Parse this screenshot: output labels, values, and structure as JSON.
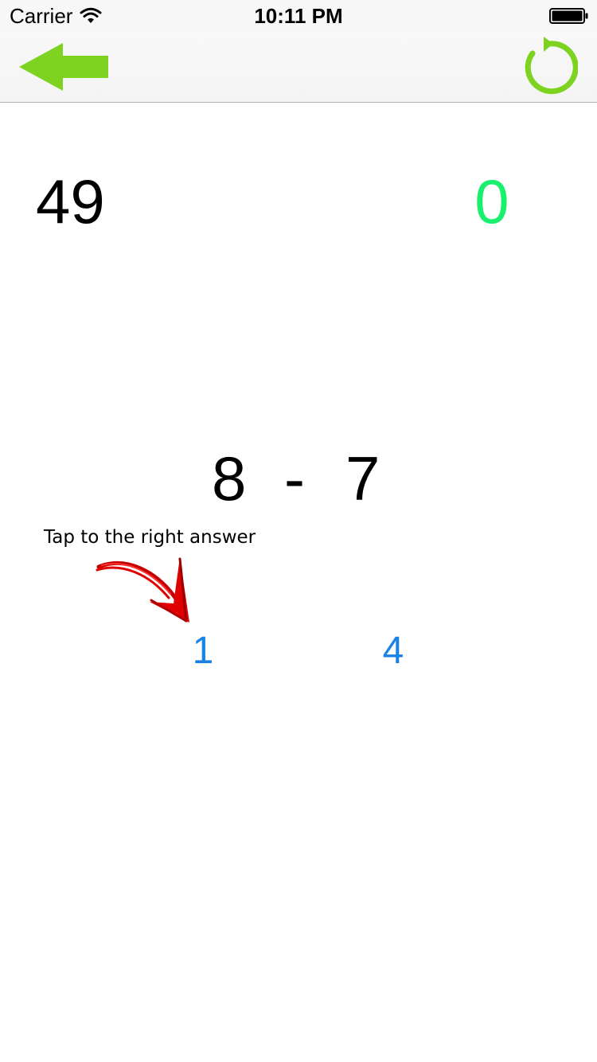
{
  "status_bar": {
    "carrier": "Carrier",
    "time": "10:11 PM"
  },
  "nav": {
    "back_icon": "left-arrow-icon",
    "refresh_icon": "refresh-icon",
    "accent_color": "#7ed321"
  },
  "scores": {
    "remaining": "49",
    "correct": "0",
    "correct_color": "#19f06e"
  },
  "question": {
    "operand_a": "8",
    "operator": "-",
    "operand_b": "7"
  },
  "hint": {
    "text": "Tap to the right answer",
    "arrow_color": "#e00000"
  },
  "answers": [
    {
      "label": "1"
    },
    {
      "label": "4"
    }
  ],
  "answer_color": "#1a82e6"
}
